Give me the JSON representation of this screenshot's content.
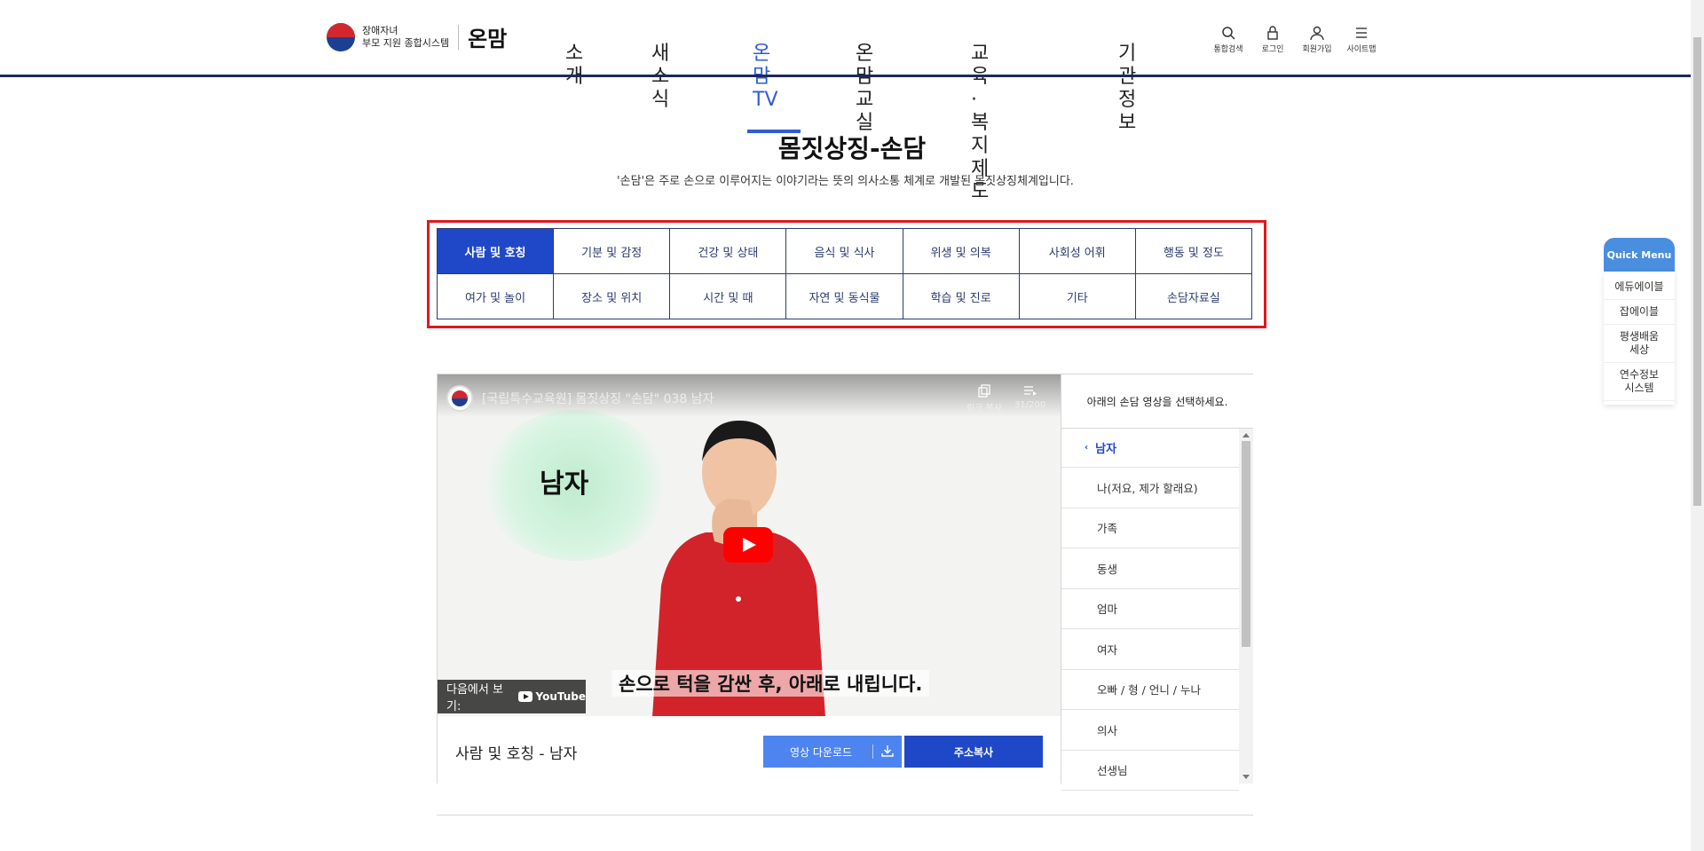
{
  "header": {
    "logo_line1": "장애자녀",
    "logo_line2": "부모 지원 종합시스템",
    "brand": "온맘",
    "nav": [
      {
        "label": "소\n개",
        "active": false
      },
      {
        "label": "새소\n식",
        "active": false
      },
      {
        "label": "온맘\nTV",
        "active": true
      },
      {
        "label": "온맘\n교실",
        "active": false
      },
      {
        "label": "교육·복지\n제도",
        "active": false
      },
      {
        "label": "기관\n정보",
        "active": false
      }
    ],
    "utility": [
      {
        "label": "통합검색",
        "icon": "search-icon"
      },
      {
        "label": "로그인",
        "icon": "lock-icon"
      },
      {
        "label": "회원가입",
        "icon": "user-icon"
      },
      {
        "label": "사이트맵",
        "icon": "menu-icon"
      }
    ]
  },
  "page": {
    "title": "몸짓상징-손담",
    "description": "'손담'은 주로 손으로 이루어지는 이야기라는 뜻의 의사소통 체계로 개발된 몸짓상징체계입니다."
  },
  "categories": [
    {
      "label": "사람 및 호칭",
      "active": true
    },
    {
      "label": "기분 및 감정",
      "active": false
    },
    {
      "label": "건강 및 상태",
      "active": false
    },
    {
      "label": "음식 및 식사",
      "active": false
    },
    {
      "label": "위생 및 의복",
      "active": false
    },
    {
      "label": "사회성 어휘",
      "active": false
    },
    {
      "label": "행동 및 정도",
      "active": false
    },
    {
      "label": "여가 및 놀이",
      "active": false
    },
    {
      "label": "장소 및 위치",
      "active": false
    },
    {
      "label": "시간 및 때",
      "active": false
    },
    {
      "label": "자연 및 동식물",
      "active": false
    },
    {
      "label": "학습 및 진로",
      "active": false
    },
    {
      "label": "기타",
      "active": false
    },
    {
      "label": "손담자료실",
      "active": false
    }
  ],
  "video": {
    "title": "[국립특수교육원] 몸짓상징 \"손담\" 038 남자",
    "copy_label": "링크 복사",
    "playlist_count": "31/200",
    "word": "남자",
    "subtitle": "손으로 턱을 감싼 후, 아래로 내립니다.",
    "watch_on": "다음에서 보기:",
    "youtube": "YouTube",
    "caption": "사람 및 호칭 - 남자",
    "download_button": "영상 다운로드",
    "copy_button": "주소복사"
  },
  "sidebar": {
    "heading": "아래의 손담 영상을 선택하세요.",
    "group": "남자",
    "items": [
      "나(저요, 제가 할래요)",
      "가족",
      "동생",
      "엄마",
      "여자",
      "오빠 / 형 / 언니 / 누나",
      "의사",
      "선생님"
    ]
  },
  "quick_menu": {
    "title": "Quick Menu",
    "items": [
      "에듀에이블",
      "잡에이블",
      "평생배움\n세상",
      "연수정보\n시스템"
    ]
  },
  "colors": {
    "accent": "#1f48c8",
    "highlight_border": "#e0181e",
    "quick_menu": "#4a8ee0"
  }
}
